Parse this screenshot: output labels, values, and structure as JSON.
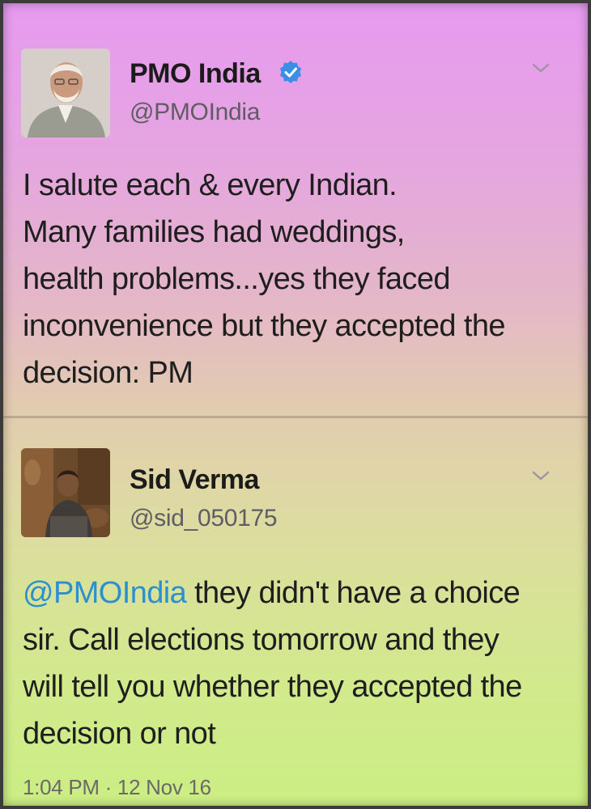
{
  "tweets": [
    {
      "display_name": "PMO India",
      "handle": "@PMOIndia",
      "verified": true,
      "text_lines": [
        "I salute each & every Indian.",
        "Many families had weddings,",
        "health problems...yes they faced",
        "inconvenience but they accepted the",
        "decision: PM"
      ]
    },
    {
      "display_name": "Sid Verma",
      "handle": "@sid_050175",
      "verified": false,
      "mention": "@PMOIndia",
      "text_first_rest": " they didn't have a choice",
      "text_lines": [
        "sir. Call elections tomorrow and they",
        "will tell you whether they accepted the",
        "decision or not"
      ],
      "timestamp": "1:04 PM · 12 Nov 16"
    }
  ],
  "colors": {
    "mention": "#2b8fd0",
    "verified_badge": "#3a8ee6",
    "background_top": "#e79af0",
    "background_bottom": "#cbee84"
  },
  "icons": {
    "verified": "verified-badge-icon",
    "menu": "chevron-down-icon"
  }
}
